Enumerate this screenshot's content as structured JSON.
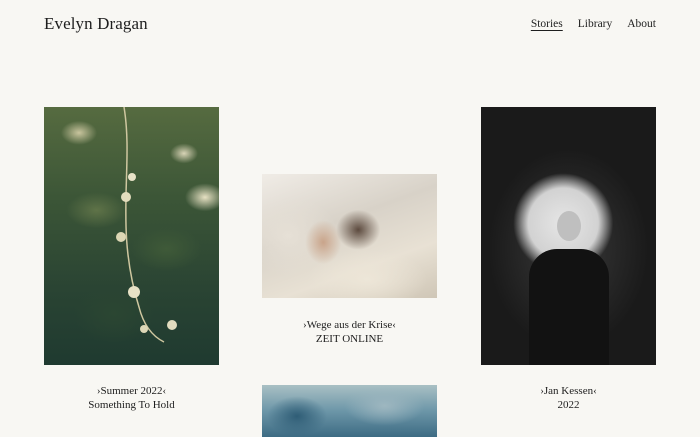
{
  "site": {
    "title": "Evelyn Dragan"
  },
  "nav": [
    {
      "label": "Stories",
      "active": true
    },
    {
      "label": "Library",
      "active": false
    },
    {
      "label": "About",
      "active": false
    }
  ],
  "cards": [
    {
      "title": "›Summer 2022‹",
      "subtitle": "Something To Hold"
    },
    {
      "title": "›Wege aus der Krise‹",
      "subtitle": "ZEIT ONLINE"
    },
    {
      "title": "›Jan Kessen‹",
      "subtitle": "2022"
    }
  ]
}
